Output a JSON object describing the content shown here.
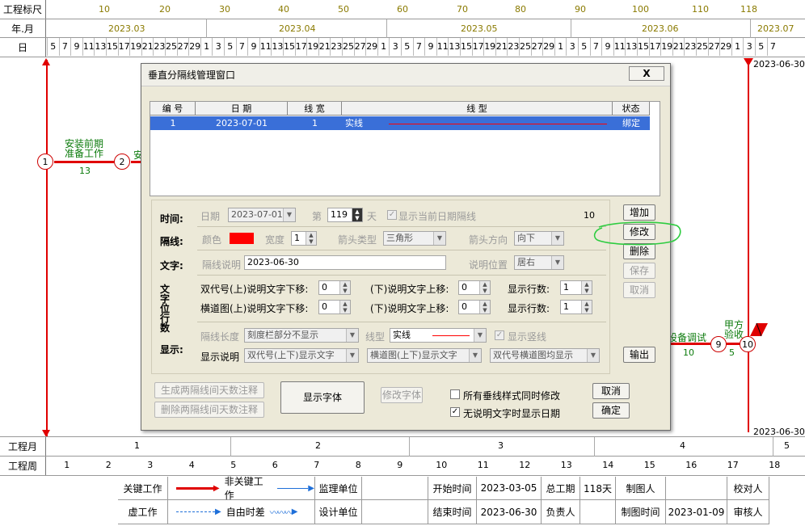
{
  "header": {
    "scale_label": "工程标尺",
    "scale_ticks": [
      "10",
      "20",
      "30",
      "40",
      "50",
      "60",
      "70",
      "80",
      "90",
      "100",
      "110",
      "118"
    ],
    "month_label": "年.月",
    "months": [
      "2023.03",
      "2023.04",
      "2023.05",
      "2023.06",
      "2023.07"
    ],
    "day_label": "日",
    "days": [
      "5",
      "7",
      "9",
      "11",
      "13",
      "15",
      "17",
      "19",
      "21",
      "23",
      "25",
      "27",
      "29",
      "1",
      "3",
      "5",
      "7",
      "9",
      "11",
      "13",
      "15",
      "17",
      "19",
      "21",
      "23",
      "25",
      "27",
      "29",
      "1",
      "3",
      "5",
      "7",
      "9",
      "11",
      "13",
      "15",
      "17",
      "19",
      "21",
      "23",
      "25",
      "27",
      "29",
      "1",
      "3",
      "5",
      "7",
      "9",
      "11",
      "13",
      "15",
      "17",
      "19",
      "21",
      "23",
      "25",
      "27",
      "29",
      "1",
      "3",
      "5",
      "7"
    ]
  },
  "chart": {
    "marker_top_date": "2023-06-30",
    "marker_bottom_date": "2023-06-30",
    "nodes": [
      "1",
      "2",
      "9",
      "10"
    ],
    "task1_name_line1": "安装前期",
    "task1_name_line2": "准备工作",
    "task1_duration": "13",
    "task2_partial": "安",
    "task9_name": "设备调试",
    "task9_duration": "10",
    "task10_name_line1": "甲方",
    "task10_name_line2": "验收",
    "task10_duration": "5"
  },
  "dialog": {
    "title": "垂直分隔线管理窗口",
    "close": "X",
    "columns": [
      "编 号",
      "日  期",
      "线 宽",
      "线         型",
      "状态"
    ],
    "row": {
      "no": "1",
      "date": "2023-07-01",
      "width": "1",
      "type": "实线",
      "status": "绑定"
    },
    "time_label": "时间:",
    "date_label": "日期",
    "date_value": "2023-07-01",
    "day_prefix": "第",
    "day_value": "119",
    "day_suffix": "天",
    "show_date_line": "显示当前日期隔线",
    "count": "10",
    "sep_label": "隔线:",
    "color_label": "颜色",
    "width_label": "宽度",
    "width_value": "1",
    "arrow_type_label": "箭头类型",
    "arrow_type_value": "三角形",
    "arrow_dir_label": "箭头方向",
    "arrow_dir_value": "向下",
    "text_label": "文字:",
    "desc_label": "隔线说明",
    "desc_value": "2023-06-30",
    "pos_label": "说明位置",
    "pos_value": "居右",
    "offset_label": "文字位行数",
    "dbl_up_label": "双代号(上)说明文字下移:",
    "dbl_up_value": "0",
    "dbl_down_label": "(下)说明文字上移:",
    "dbl_down_value": "0",
    "dbl_rows_label": "显示行数:",
    "dbl_rows_value": "1",
    "hz_up_label": "横道图(上)说明文字下移:",
    "hz_up_value": "0",
    "hz_down_label": "(下)说明文字上移:",
    "hz_down_value": "0",
    "hz_rows_label": "显示行数:",
    "hz_rows_value": "1",
    "display_label": "显示:",
    "length_label": "隔线长度",
    "length_value": "刻度栏部分不显示",
    "linetype_label": "线型",
    "linetype_value": "实线",
    "show_vline": "显示竖线",
    "show_desc_label": "显示说明",
    "show_desc_1": "双代号(上下)显示文字",
    "show_desc_2": "横道图(上下)显示文字",
    "show_desc_3": "双代号横道图均显示",
    "btn_add": "增加",
    "btn_modify": "修改",
    "btn_delete": "删除",
    "btn_save": "保存",
    "btn_cancel_edit": "取消",
    "btn_export": "输出",
    "btn_gen_days": "生成两隔线间天数注释",
    "btn_del_days": "删除两隔线间天数注释",
    "btn_font": "显示字体",
    "btn_modify_font": "修改字体",
    "chk_all": "所有垂线样式同时修改",
    "chk_no_desc": "无说明文字时显示日期",
    "btn_cancel": "取消",
    "btn_ok": "确定",
    "accent": "#3a6fd8",
    "line_color": "#ff0000"
  },
  "footer": {
    "month_row_label": "工程月",
    "month_values": [
      "1",
      "2",
      "3",
      "4",
      "5"
    ],
    "week_row_label": "工程周",
    "week_values": [
      "1",
      "2",
      "3",
      "4",
      "5",
      "6",
      "7",
      "8",
      "9",
      "10",
      "11",
      "12",
      "13",
      "14",
      "15",
      "16",
      "17",
      "18"
    ],
    "legend_critical": "关键工作",
    "legend_noncritical": "非关键工作",
    "legend_virtual": "虚工作",
    "legend_float": "自由时差",
    "supervisor_label": "监理单位",
    "design_label": "设计单位",
    "start_label": "开始时间",
    "start_value": "2023-03-05",
    "end_label": "结束时间",
    "end_value": "2023-06-30",
    "total_label": "总工期",
    "total_value": "118天",
    "manager_label": "负责人",
    "drawer_label": "制图人",
    "draw_time_label": "制图时间",
    "draw_time_value": "2023-01-09",
    "checker_label": "校对人",
    "reviewer_label": "审核人"
  }
}
